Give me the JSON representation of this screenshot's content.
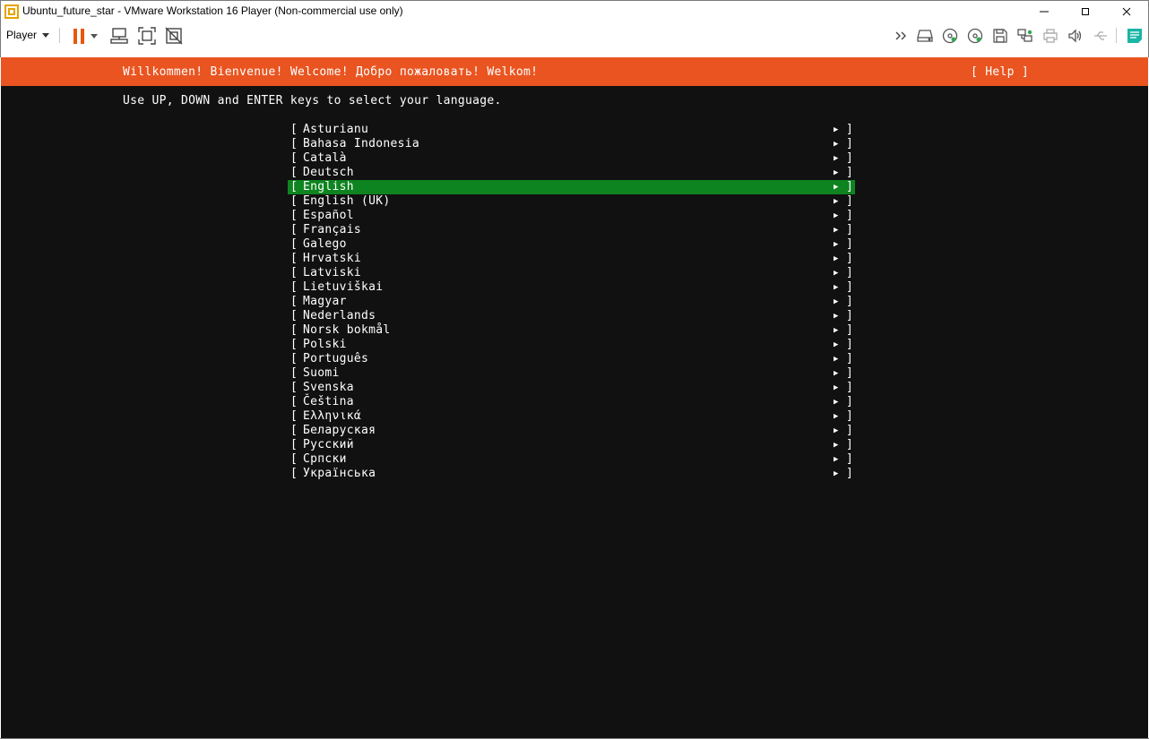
{
  "window": {
    "title": "Ubuntu_future_star - VMware Workstation 16 Player (Non-commercial use only)"
  },
  "toolbar": {
    "player_label": "Player",
    "accent_color": "#e8580c",
    "left_icons": [
      "pause-icon",
      "dropdown-arrow-icon",
      "send-ctrl-alt-del-icon",
      "fullscreen-icon",
      "unity-icon"
    ],
    "right_icons": [
      "more-devices-icon",
      "hard-disk-icon",
      "cd-dvd-icon",
      "cd-dvd-2-icon",
      "floppy-icon",
      "network-adapter-icon",
      "printer-icon",
      "sound-card-icon",
      "usb-icon",
      "message-log-icon"
    ]
  },
  "console": {
    "banner_color": "#e95420",
    "selection_color": "#0e8420",
    "banner_text": "Willkommen! Bienvenue! Welcome! Добро пожаловать! Welkom!",
    "help_label": "[ Help ]",
    "instruction": "Use UP, DOWN and ENTER keys to select your language.",
    "bracket_open": "[",
    "bracket_close": "]",
    "arrow": "▶",
    "selected_index": 4,
    "languages": [
      "Asturianu",
      "Bahasa Indonesia",
      "Català",
      "Deutsch",
      "English",
      "English (UK)",
      "Español",
      "Français",
      "Galego",
      "Hrvatski",
      "Latviski",
      "Lietuviškai",
      "Magyar",
      "Nederlands",
      "Norsk bokmål",
      "Polski",
      "Português",
      "Suomi",
      "Svenska",
      "Čeština",
      "Ελληνικά",
      "Беларуская",
      "Русский",
      "Српски",
      "Українська"
    ]
  }
}
